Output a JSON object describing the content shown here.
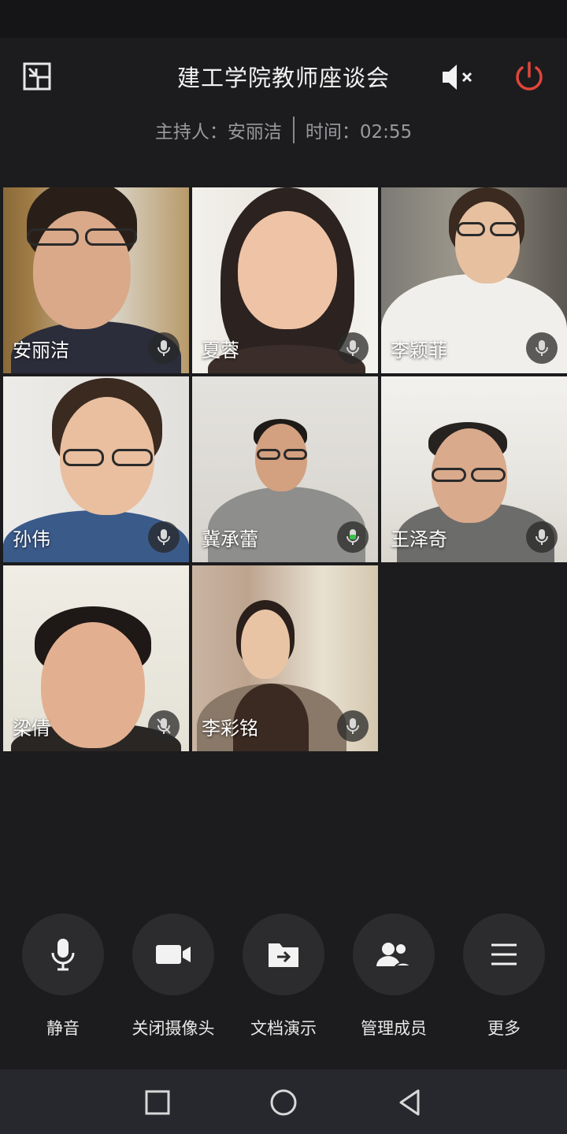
{
  "header": {
    "title": "建工学院教师座谈会",
    "host_text": "主持人：安丽洁",
    "time_text": "时间：02:55"
  },
  "participants": [
    {
      "name": "安丽洁",
      "mic": "on"
    },
    {
      "name": "夏蓉",
      "mic": "on"
    },
    {
      "name": "李颖菲",
      "mic": "on"
    },
    {
      "name": "孙伟",
      "mic": "on"
    },
    {
      "name": "冀承蕾",
      "mic": "speaking"
    },
    {
      "name": "王泽奇",
      "mic": "on"
    },
    {
      "name": "梁倩",
      "mic": "muted"
    },
    {
      "name": "李彩铭",
      "mic": "on"
    }
  ],
  "toolbar": {
    "mute": "静音",
    "camera": "关闭摄像头",
    "share_doc": "文档演示",
    "members": "管理成员",
    "more": "更多"
  },
  "colors": {
    "accent_power": "#e0463a",
    "speaking_mic": "#37c24a",
    "background": "#1c1c1e"
  }
}
